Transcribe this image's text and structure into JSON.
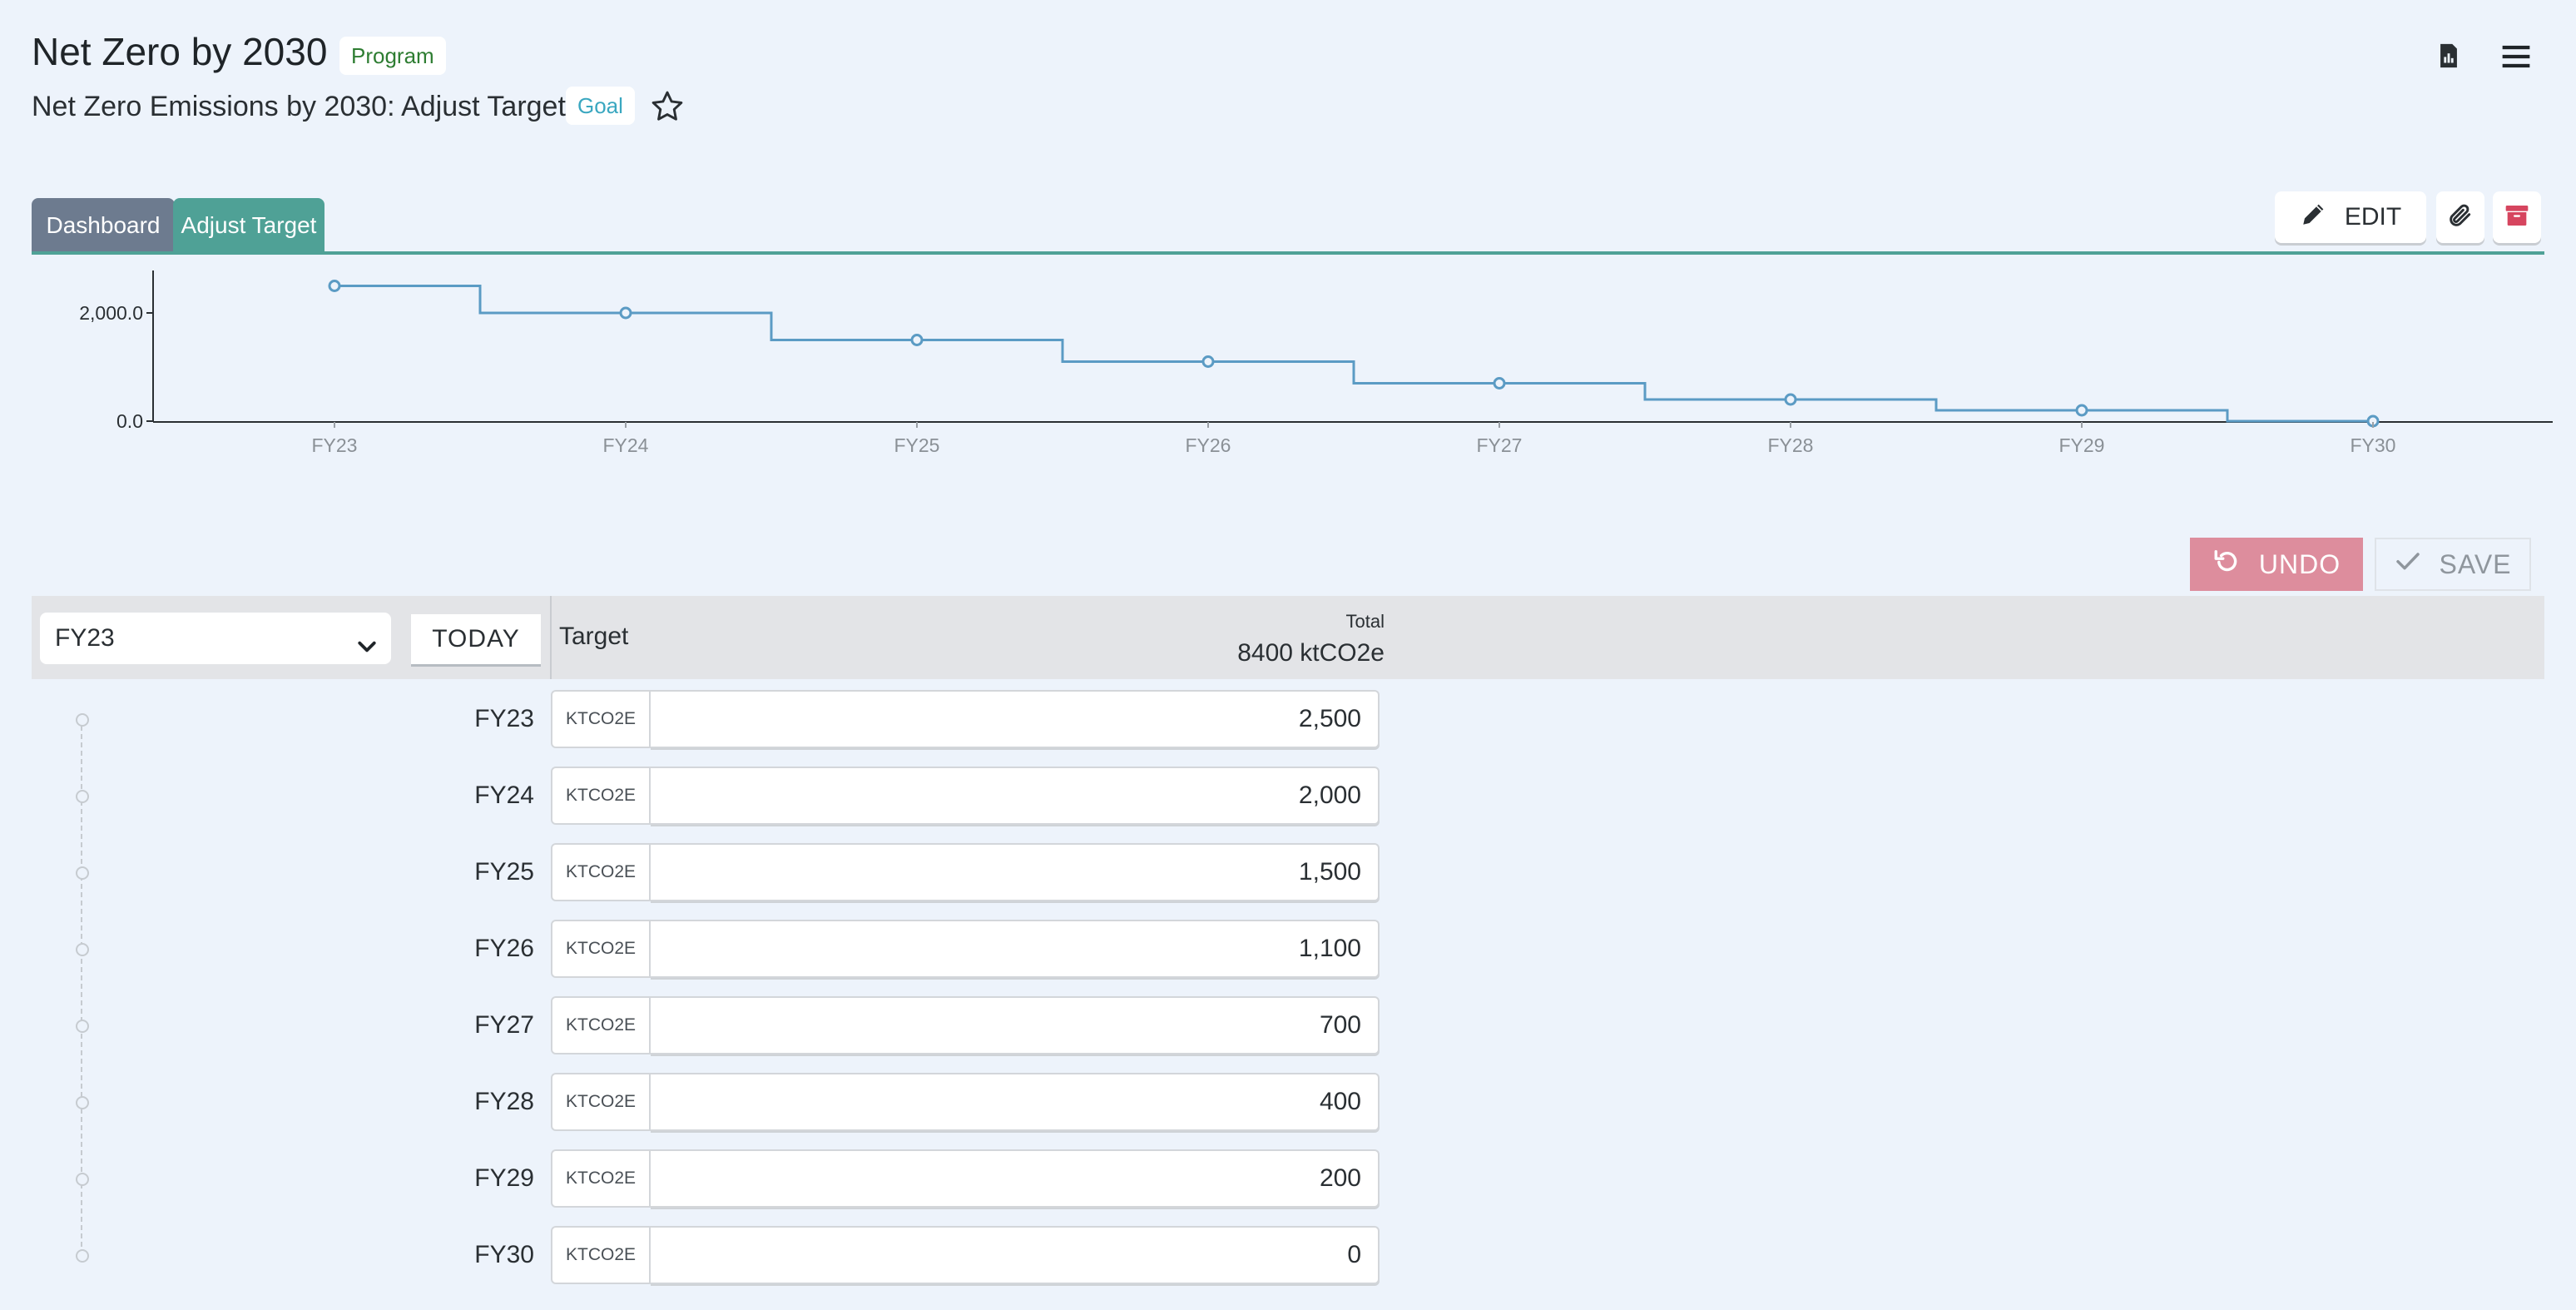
{
  "header": {
    "title": "Net Zero by 2030",
    "title_badge": "Program",
    "subtitle": "Net Zero Emissions by 2030: Adjust Target",
    "subtitle_badge": "Goal"
  },
  "icons": {
    "star": "star-icon",
    "document": "document-icon",
    "menu": "hamburger-menu-icon",
    "edit": "pencil-icon",
    "attach": "paperclip-icon",
    "archive": "archive-icon",
    "undo": "undo-icon",
    "save": "check-icon",
    "dropdown": "chevron-down-icon"
  },
  "tabs": [
    {
      "label": "Dashboard",
      "active": false
    },
    {
      "label": "Adjust Target",
      "active": true
    }
  ],
  "toolbar": {
    "edit_label": "EDIT"
  },
  "actions": {
    "undo_label": "UNDO",
    "save_label": "SAVE"
  },
  "colors": {
    "background": "#edf3fb",
    "tab_inactive": "#6d7b8f",
    "tab_active": "#4fa196",
    "undo": "#dd8d9d",
    "archive": "#d6455f",
    "line": "#5b9bc4"
  },
  "chart_data": {
    "type": "line",
    "step": true,
    "categories": [
      "FY23",
      "FY24",
      "FY25",
      "FY26",
      "FY27",
      "FY28",
      "FY29",
      "FY30"
    ],
    "values": [
      2500,
      2000,
      1500,
      1100,
      700,
      400,
      200,
      0
    ],
    "ytick_labels": [
      "0.0",
      "2,000.0"
    ],
    "ytick_values": [
      0,
      2000
    ],
    "ylim": [
      0,
      3000
    ]
  },
  "table": {
    "selected_year": "FY23",
    "today_label": "TODAY",
    "target_label": "Target",
    "total_label": "Total",
    "total_value": "8400 ktCO2e",
    "unit": "KTCO2E",
    "rows": [
      {
        "year": "FY23",
        "value": "2,500"
      },
      {
        "year": "FY24",
        "value": "2,000"
      },
      {
        "year": "FY25",
        "value": "1,500"
      },
      {
        "year": "FY26",
        "value": "1,100"
      },
      {
        "year": "FY27",
        "value": "700"
      },
      {
        "year": "FY28",
        "value": "400"
      },
      {
        "year": "FY29",
        "value": "200"
      },
      {
        "year": "FY30",
        "value": "0"
      }
    ]
  }
}
